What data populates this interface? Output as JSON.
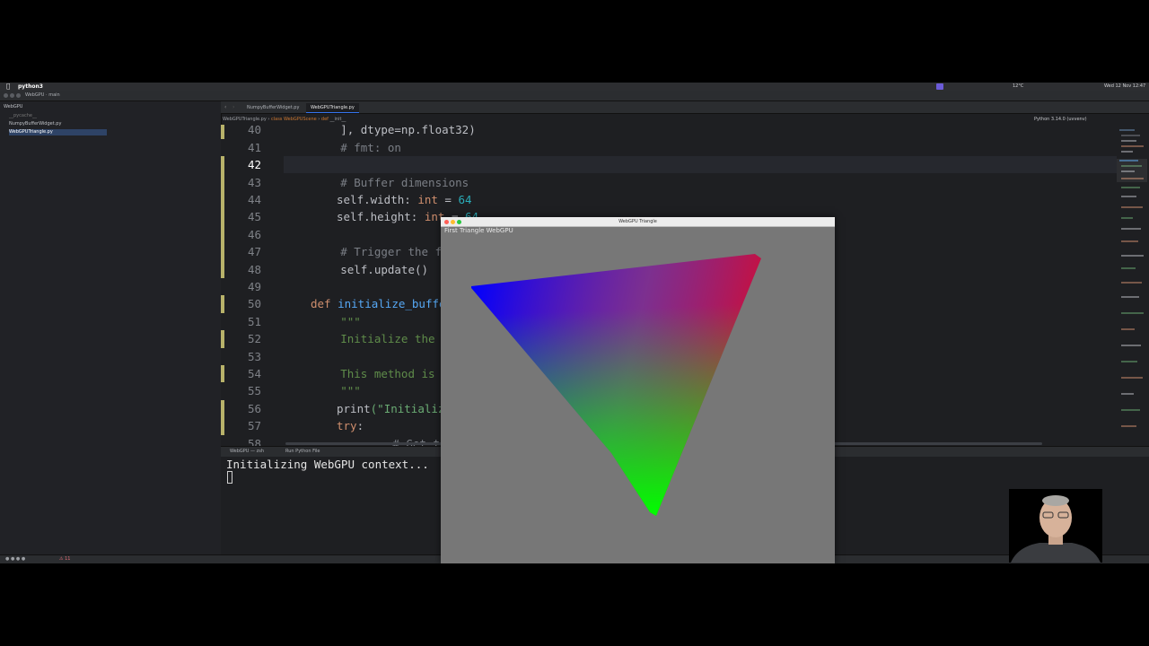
{
  "menubar": {
    "app_name": "python3",
    "clock": "Wed 12 Nov 12:47",
    "temperature": "12°C"
  },
  "window": {
    "project": "WebGPU",
    "branch": "main"
  },
  "sidebar": {
    "items": [
      {
        "label": "WebGPU",
        "selected": false
      },
      {
        "label": "__pycache__",
        "selected": false
      },
      {
        "label": "NumpyBufferWidget.py",
        "selected": false
      },
      {
        "label": "WebGPUTriangle.py",
        "selected": true
      }
    ]
  },
  "editor": {
    "tabs": [
      {
        "label": "NumpyBufferWidget.py",
        "active": false
      },
      {
        "label": "WebGPUTriangle.py",
        "active": true
      }
    ],
    "breadcrumb": {
      "file": "WebGPUTriangle.py",
      "class_kw": "class",
      "class_name": "WebGPUScene",
      "def_kw": "def",
      "method": "__init__"
    },
    "interpreter": "Python 3.14.0 (uvvenv)",
    "lines": [
      {
        "num": "40",
        "text": "        ], dtype=np.float32)"
      },
      {
        "num": "41",
        "text": "        # fmt: on"
      },
      {
        "num": "42",
        "text": ""
      },
      {
        "num": "43",
        "text": "        # Buffer dimensions"
      },
      {
        "num": "44",
        "kw_self": "self",
        "attr": ".width: ",
        "type": "int",
        "eq": " = ",
        "val": "64"
      },
      {
        "num": "45",
        "kw_self": "self",
        "attr": ".height: ",
        "type": "int",
        "eq": " = ",
        "val": "64"
      },
      {
        "num": "46",
        "text": ""
      },
      {
        "num": "47",
        "text": "        # Trigger the fi"
      },
      {
        "num": "48",
        "text": "        self.update()"
      },
      {
        "num": "49",
        "text": ""
      },
      {
        "num": "50",
        "def": "def",
        "name": "initialize_buffe"
      },
      {
        "num": "51",
        "text": "        \"\"\""
      },
      {
        "num": "52",
        "text": "        Initialize the We"
      },
      {
        "num": "53",
        "text": ""
      },
      {
        "num": "54",
        "text": "        This method is ca"
      },
      {
        "num": "55",
        "text": "        \"\"\""
      },
      {
        "num": "56",
        "call": "print",
        "arg": "(\"Initializ"
      },
      {
        "num": "57",
        "try": "try",
        "colon": ":"
      },
      {
        "num": "58",
        "text": "            # Get the d"
      }
    ]
  },
  "terminal": {
    "tabs": [
      "WebGPU — zsh",
      "Run Python File"
    ],
    "output": "Initializing WebGPU context..."
  },
  "gpu_window": {
    "title": "WebGPU Triangle",
    "label": "First Triangle WebGPU",
    "colors": {
      "top_left": "#0000ff",
      "top_right": "#ff0000",
      "bottom": "#00ff00",
      "background": "#777777"
    }
  },
  "statusbar": {
    "problems": "11"
  }
}
